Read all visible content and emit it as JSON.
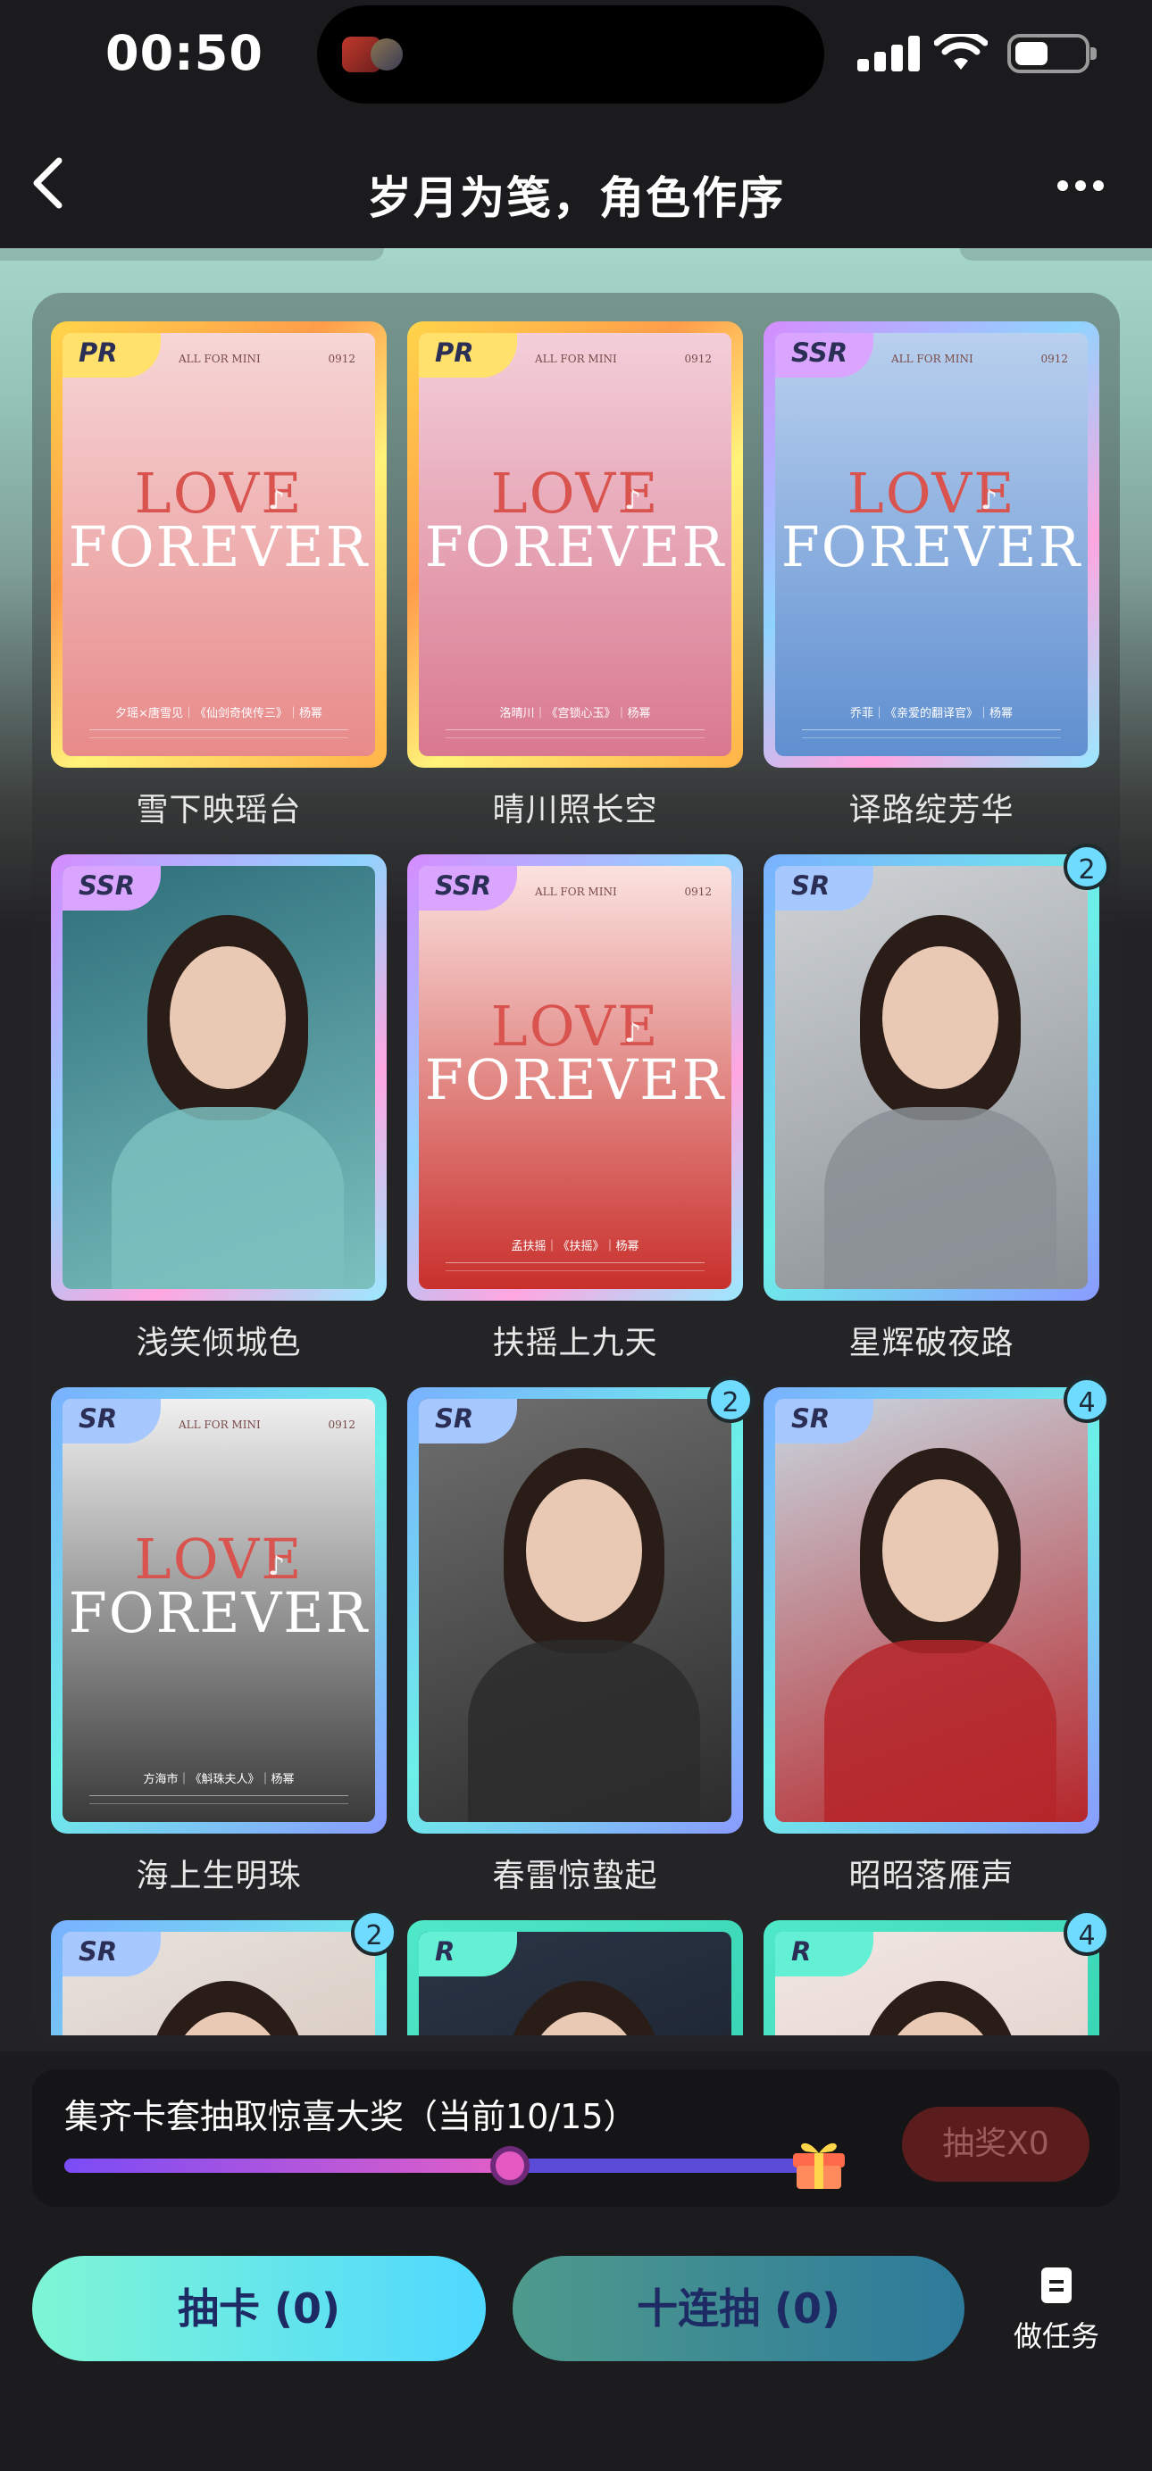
{
  "status": {
    "time": "00:50"
  },
  "nav": {
    "title": "岁月为笺，角色作序"
  },
  "cards": [
    {
      "name": "雪下映瑶台",
      "rarity": "PR",
      "count": "",
      "style": "poster",
      "tint": "pink",
      "credit": "夕瑶×唐雪见｜《仙剑奇侠传三》｜杨幂"
    },
    {
      "name": "晴川照长空",
      "rarity": "PR",
      "count": "",
      "style": "poster",
      "tint": "rose",
      "credit": "洛晴川｜《宫锁心玉》｜杨幂"
    },
    {
      "name": "译路绽芳华",
      "rarity": "SSR",
      "count": "",
      "style": "poster",
      "tint": "blue",
      "credit": "乔菲｜《亲爱的翻译官》｜杨幂"
    },
    {
      "name": "浅笑倾城色",
      "rarity": "SSR",
      "count": "",
      "style": "photo",
      "tint": "teal"
    },
    {
      "name": "扶摇上九天",
      "rarity": "SSR",
      "count": "",
      "style": "poster",
      "tint": "red",
      "credit": "孟扶摇｜《扶摇》｜杨幂"
    },
    {
      "name": "星辉破夜路",
      "rarity": "SR",
      "count": "2",
      "style": "photo",
      "tint": "street"
    },
    {
      "name": "海上生明珠",
      "rarity": "SR",
      "count": "",
      "style": "poster",
      "tint": "gray",
      "credit": "方海市｜《斛珠夫人》｜杨幂"
    },
    {
      "name": "春雷惊蛰起",
      "rarity": "SR",
      "count": "2",
      "style": "photo",
      "tint": "city"
    },
    {
      "name": "昭昭落雁声",
      "rarity": "SR",
      "count": "4",
      "style": "photo",
      "tint": "ancient"
    },
    {
      "name": "",
      "rarity": "SR",
      "count": "2",
      "style": "photo",
      "tint": "light"
    },
    {
      "name": "",
      "rarity": "R",
      "count": "",
      "style": "photo",
      "tint": "dark"
    },
    {
      "name": "",
      "rarity": "R",
      "count": "4",
      "style": "photo",
      "tint": "soft"
    }
  ],
  "poster_text": {
    "top_left": "ALL FOR MINI",
    "top_right": "0912",
    "word1": "LOVE",
    "word2": "FOREVER"
  },
  "progress": {
    "label": "集齐卡套抽取惊喜大奖（当前10/15）",
    "current": 10,
    "total": 15,
    "draw_label": "抽奖X0"
  },
  "actions": {
    "draw": "抽卡 (0)",
    "ten_draw": "十连抽 (0)",
    "task": "做任务"
  },
  "colors": {
    "accent": "#4fd8ff",
    "progress": "#e25fc6"
  }
}
